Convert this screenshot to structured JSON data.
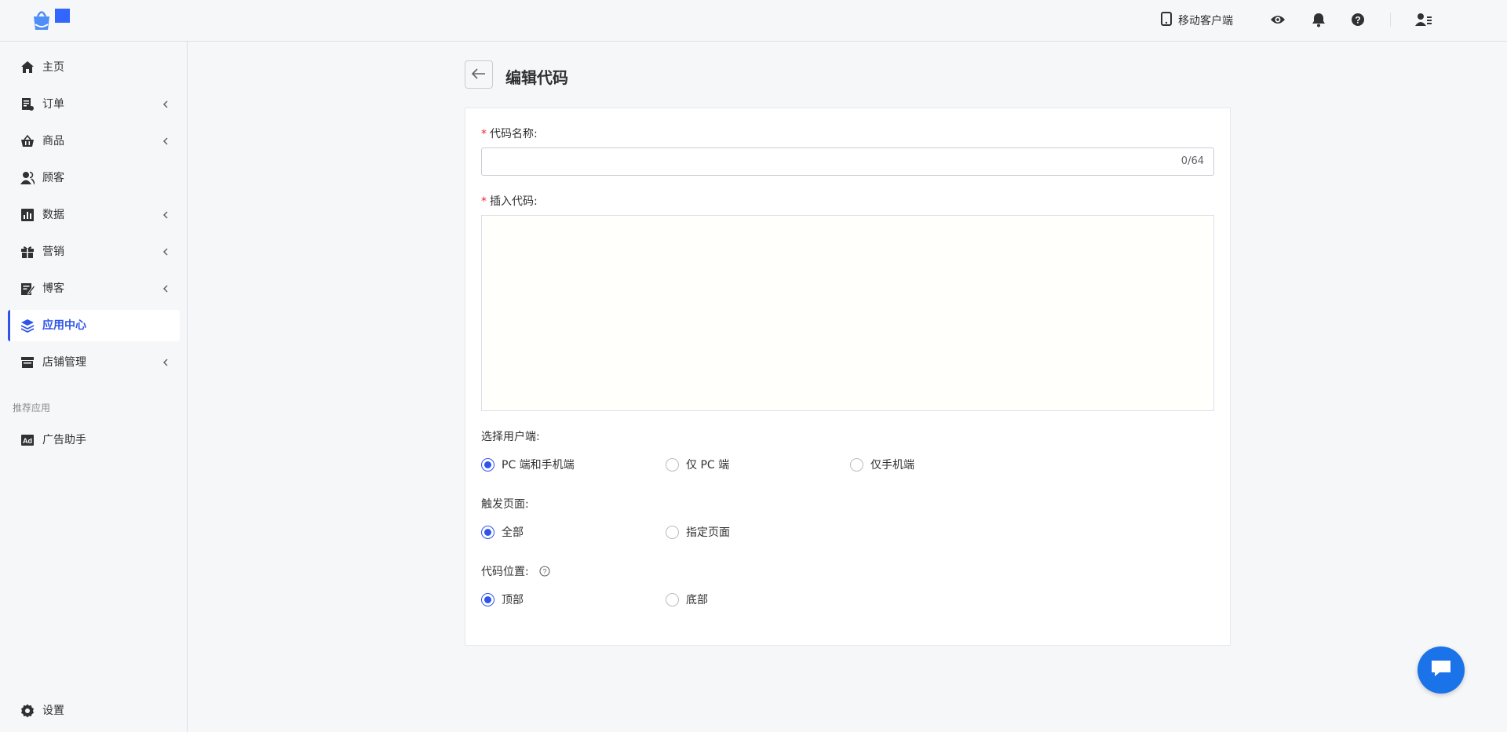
{
  "header": {
    "mobile_client_label": "移动客户端",
    "icons": [
      "phone-icon",
      "eye-icon",
      "bell-icon",
      "help-icon",
      "user-menu-icon"
    ]
  },
  "sidebar": {
    "items": [
      {
        "label": "主页",
        "icon": "home-icon",
        "expandable": false
      },
      {
        "label": "订单",
        "icon": "orders-icon",
        "expandable": true
      },
      {
        "label": "商品",
        "icon": "basket-icon",
        "expandable": true
      },
      {
        "label": "顾客",
        "icon": "customers-icon",
        "expandable": false
      },
      {
        "label": "数据",
        "icon": "chart-icon",
        "expandable": true
      },
      {
        "label": "营销",
        "icon": "gift-icon",
        "expandable": true
      },
      {
        "label": "博客",
        "icon": "blog-icon",
        "expandable": true
      },
      {
        "label": "应用中心",
        "icon": "layers-icon",
        "expandable": false,
        "active": true
      },
      {
        "label": "店铺管理",
        "icon": "store-icon",
        "expandable": true
      }
    ],
    "recommended_label": "推荐应用",
    "recommended_items": [
      {
        "label": "广告助手",
        "icon": "ad-icon"
      }
    ],
    "settings_label": "设置"
  },
  "main": {
    "title": "编辑代码",
    "form": {
      "name_label": "代码名称:",
      "name_value": "",
      "name_counter": "0/64",
      "code_label": "插入代码:",
      "code_value": "",
      "client_label": "选择用户端:",
      "client_options": [
        "PC 端和手机端",
        "仅 PC 端",
        "仅手机端"
      ],
      "client_selected": "PC 端和手机端",
      "trigger_label": "触发页面:",
      "trigger_options": [
        "全部",
        "指定页面"
      ],
      "trigger_selected": "全部",
      "position_label": "代码位置:",
      "position_options": [
        "顶部",
        "底部"
      ],
      "position_selected": "顶部"
    }
  },
  "colors": {
    "accent": "#2f54eb",
    "required": "#f5222d",
    "chat_button": "#1a73e8"
  }
}
